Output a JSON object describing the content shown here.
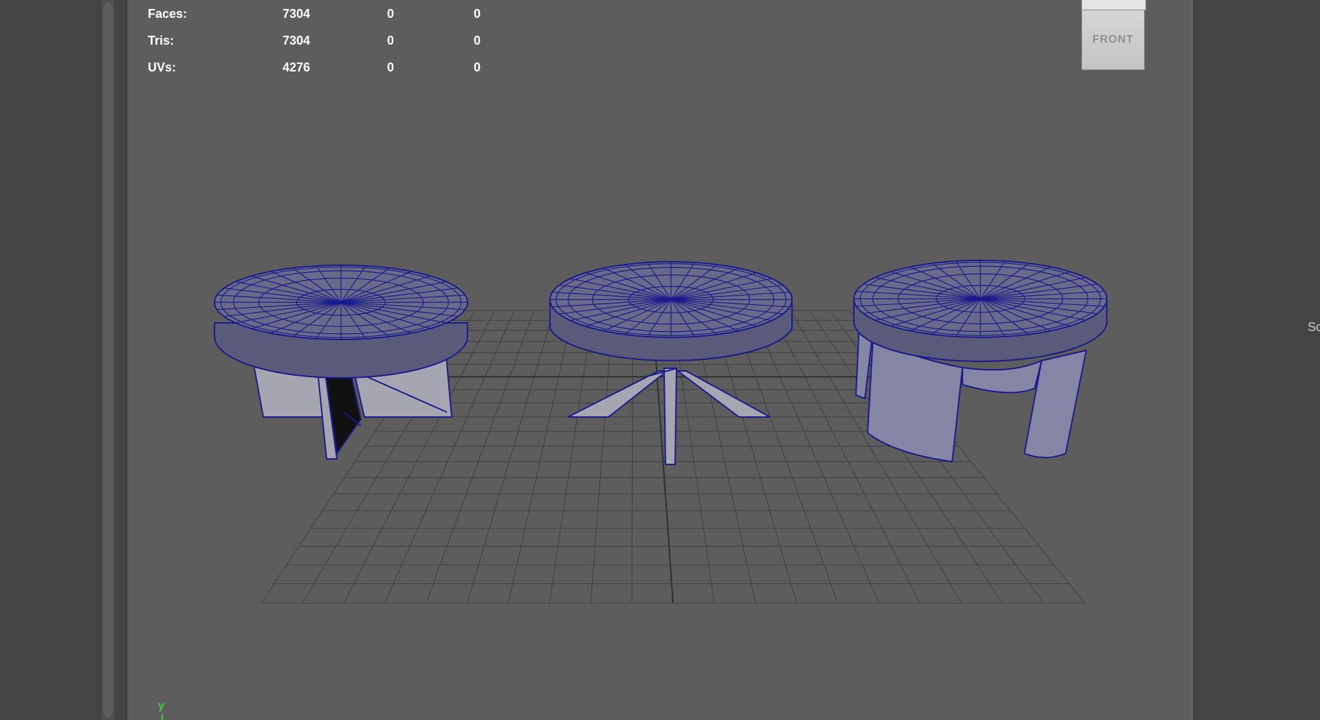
{
  "hud": {
    "rows": [
      {
        "label": "Faces:",
        "v1": "7304",
        "v2": "0",
        "v3": "0"
      },
      {
        "label": "Tris:",
        "v1": "7304",
        "v2": "0",
        "v3": "0"
      },
      {
        "label": "UVs:",
        "v1": "4276",
        "v2": "0",
        "v3": "0"
      }
    ]
  },
  "viewcube": {
    "face_label": "FRONT"
  },
  "axis": {
    "y_label": "y"
  },
  "side_panel": {
    "cut_label": "Sc"
  },
  "colors": {
    "viewport_bg": "#5d5d5d",
    "wireframe": "#1a1a8c",
    "grid": "#3f3f3f",
    "leg_fill": "#a9a9b5"
  }
}
